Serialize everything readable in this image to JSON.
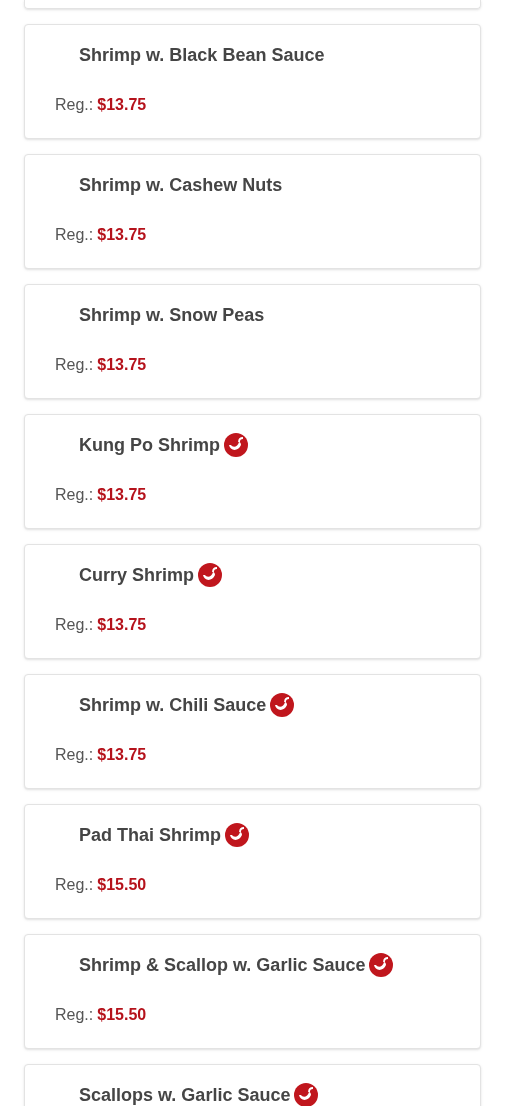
{
  "items": [
    {
      "name": "Shrimp w. Black Bean Sauce",
      "spicy": false,
      "price_label": "Reg.:",
      "price": "$13.75"
    },
    {
      "name": "Shrimp w. Cashew Nuts",
      "spicy": false,
      "price_label": "Reg.:",
      "price": "$13.75"
    },
    {
      "name": "Shrimp w. Snow Peas",
      "spicy": false,
      "price_label": "Reg.:",
      "price": "$13.75"
    },
    {
      "name": "Kung Po Shrimp",
      "spicy": true,
      "price_label": "Reg.:",
      "price": "$13.75"
    },
    {
      "name": "Curry Shrimp",
      "spicy": true,
      "price_label": "Reg.:",
      "price": "$13.75"
    },
    {
      "name": "Shrimp w. Chili Sauce",
      "spicy": true,
      "price_label": "Reg.:",
      "price": "$13.75"
    },
    {
      "name": "Pad Thai Shrimp",
      "spicy": true,
      "price_label": "Reg.:",
      "price": "$15.50"
    },
    {
      "name": "Shrimp & Scallop w. Garlic Sauce",
      "spicy": true,
      "price_label": "Reg.:",
      "price": "$15.50"
    },
    {
      "name": "Scallops w. Garlic Sauce",
      "spicy": true
    }
  ]
}
